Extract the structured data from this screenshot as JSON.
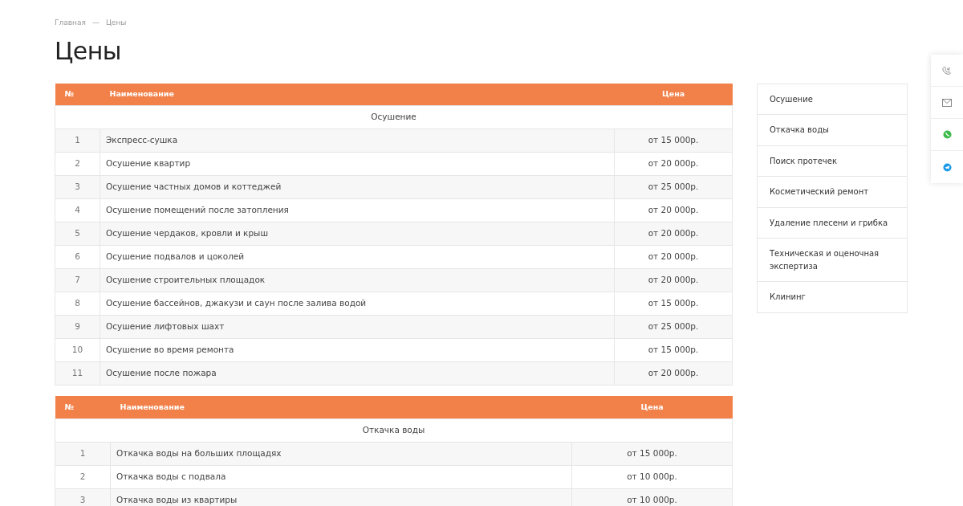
{
  "breadcrumbs": [
    {
      "label": "Главная"
    },
    {
      "label": "Цены"
    }
  ],
  "breadcrumb_separator": "—",
  "title": "Цены",
  "tables": [
    {
      "columns": [
        "№",
        "Наименование",
        "Цена"
      ],
      "section": "Осушение",
      "rows": [
        {
          "number": "1",
          "name": "Экспресс-сушка",
          "price": "от 15 000р."
        },
        {
          "number": "2",
          "name": "Осушение квартир",
          "price": "от 20 000р."
        },
        {
          "number": "3",
          "name": "Осушение частных домов и коттеджей",
          "price": "от 25 000р."
        },
        {
          "number": "4",
          "name": "Осушение помещений после затопления",
          "price": "от 20 000р."
        },
        {
          "number": "5",
          "name": "Осушение чердаков, кровли и крыш",
          "price": "от 20 000р."
        },
        {
          "number": "6",
          "name": "Осушение подвалов и цоколей",
          "price": "от 20 000р."
        },
        {
          "number": "7",
          "name": "Осушение строительных площадок",
          "price": "от 20 000р."
        },
        {
          "number": "8",
          "name": "Осушение бассейнов, джакузи и саун после залива водой",
          "price": "от 15 000р."
        },
        {
          "number": "9",
          "name": "Осушение лифтовых шахт",
          "price": "от 25 000р."
        },
        {
          "number": "10",
          "name": "Осушение во время ремонта",
          "price": "от 15 000р."
        },
        {
          "number": "11",
          "name": "Осушение после пожара",
          "price": "от 20 000р."
        }
      ]
    },
    {
      "columns": [
        "№",
        "Наименование",
        "Цена"
      ],
      "section": "Откачка воды",
      "rows": [
        {
          "number": "1",
          "name": "Откачка воды на больших площадях",
          "price": "от 15 000р."
        },
        {
          "number": "2",
          "name": "Откачка воды с подвала",
          "price": "от 10 000р."
        },
        {
          "number": "3",
          "name": "Откачка воды из квартиры",
          "price": "от 10 000р."
        }
      ]
    }
  ],
  "sidebar": {
    "items": [
      {
        "label": "Осушение"
      },
      {
        "label": "Откачка воды"
      },
      {
        "label": "Поиск протечек"
      },
      {
        "label": "Косметический ремонт"
      },
      {
        "label": "Удаление плесени и грибка"
      },
      {
        "label": "Техническая и оценочная экспертиза"
      },
      {
        "label": "Клининг"
      }
    ]
  },
  "contact_panel": {
    "items": [
      {
        "kind": "callback"
      },
      {
        "kind": "email"
      },
      {
        "kind": "whatsapp"
      },
      {
        "kind": "telegram"
      }
    ]
  }
}
